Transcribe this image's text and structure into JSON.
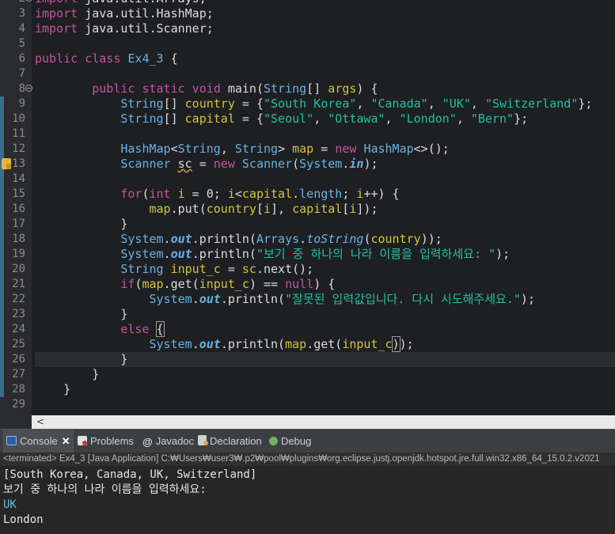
{
  "editor": {
    "lines": [
      {
        "n": "2",
        "fold": true,
        "tokens": [
          [
            "kw",
            "import"
          ],
          [
            "pu",
            " java.util.Arrays;"
          ]
        ]
      },
      {
        "n": "3",
        "tokens": [
          [
            "kw",
            "import"
          ],
          [
            "pu",
            " java.util.HashMap;"
          ]
        ]
      },
      {
        "n": "4",
        "tokens": [
          [
            "kw",
            "import"
          ],
          [
            "pu",
            " java.util.Scanner;"
          ]
        ]
      },
      {
        "n": "5",
        "tokens": []
      },
      {
        "n": "6",
        "tokens": [
          [
            "kw",
            "public class "
          ],
          [
            "ty",
            "Ex4_3"
          ],
          [
            "pu",
            " {"
          ]
        ]
      },
      {
        "n": "7",
        "tokens": []
      },
      {
        "n": "8",
        "fold": true,
        "tokens": [
          [
            "pu",
            "        "
          ],
          [
            "kw",
            "public static void "
          ],
          [
            "mth",
            "main"
          ],
          [
            "pu",
            "("
          ],
          [
            "ty",
            "String"
          ],
          [
            "pu",
            "[] "
          ],
          [
            "fld",
            "args"
          ],
          [
            "pu",
            ") {"
          ]
        ]
      },
      {
        "n": "9",
        "tokens": [
          [
            "pu",
            "            "
          ],
          [
            "ty",
            "String"
          ],
          [
            "pu",
            "[] "
          ],
          [
            "fld",
            "country"
          ],
          [
            "pu",
            " = {"
          ],
          [
            "str",
            "\"South Korea\""
          ],
          [
            "pu",
            ", "
          ],
          [
            "str",
            "\"Canada\""
          ],
          [
            "pu",
            ", "
          ],
          [
            "str",
            "\"UK\""
          ],
          [
            "pu",
            ", "
          ],
          [
            "str",
            "\"Switzerland\""
          ],
          [
            "pu",
            "};"
          ]
        ]
      },
      {
        "n": "10",
        "tokens": [
          [
            "pu",
            "            "
          ],
          [
            "ty",
            "String"
          ],
          [
            "pu",
            "[] "
          ],
          [
            "fld",
            "capital"
          ],
          [
            "pu",
            " = {"
          ],
          [
            "str",
            "\"Seoul\""
          ],
          [
            "pu",
            ", "
          ],
          [
            "str",
            "\"Ottawa\""
          ],
          [
            "pu",
            ", "
          ],
          [
            "str",
            "\"London\""
          ],
          [
            "pu",
            ", "
          ],
          [
            "str",
            "\"Bern\""
          ],
          [
            "pu",
            "};"
          ]
        ]
      },
      {
        "n": "11",
        "tokens": []
      },
      {
        "n": "12",
        "tokens": [
          [
            "pu",
            "            "
          ],
          [
            "ty",
            "HashMap"
          ],
          [
            "pu",
            "<"
          ],
          [
            "ty",
            "String"
          ],
          [
            "pu",
            ", "
          ],
          [
            "ty",
            "String"
          ],
          [
            "pu",
            "> "
          ],
          [
            "fld",
            "map"
          ],
          [
            "pu",
            " = "
          ],
          [
            "kw",
            "new "
          ],
          [
            "ty",
            "HashMap"
          ],
          [
            "pu",
            "<>();"
          ]
        ]
      },
      {
        "n": "13",
        "warn": true,
        "tokens": [
          [
            "pu",
            "            "
          ],
          [
            "ty",
            "Scanner "
          ],
          [
            "squig",
            "sc"
          ],
          [
            "pu",
            " = "
          ],
          [
            "kw",
            "new "
          ],
          [
            "ty",
            "Scanner"
          ],
          [
            "pu",
            "("
          ],
          [
            "ty",
            "System"
          ],
          [
            "pu",
            "."
          ],
          [
            "sfld",
            "in"
          ],
          [
            "pu",
            ");"
          ]
        ]
      },
      {
        "n": "14",
        "tokens": []
      },
      {
        "n": "15",
        "tokens": [
          [
            "pu",
            "            "
          ],
          [
            "kw",
            "for"
          ],
          [
            "pu",
            "("
          ],
          [
            "kw",
            "int "
          ],
          [
            "fld",
            "i"
          ],
          [
            "pu",
            " = 0; "
          ],
          [
            "fld",
            "i"
          ],
          [
            "pu",
            "<"
          ],
          [
            "fld",
            "capital"
          ],
          [
            "pu",
            "."
          ],
          [
            "ty",
            "length"
          ],
          [
            "pu",
            "; "
          ],
          [
            "fld",
            "i"
          ],
          [
            "pu",
            "++) {"
          ]
        ]
      },
      {
        "n": "16",
        "tokens": [
          [
            "pu",
            "                "
          ],
          [
            "fld",
            "map"
          ],
          [
            "pu",
            ".put("
          ],
          [
            "fld",
            "country"
          ],
          [
            "pu",
            "["
          ],
          [
            "fld",
            "i"
          ],
          [
            "pu",
            "], "
          ],
          [
            "fld",
            "capital"
          ],
          [
            "pu",
            "["
          ],
          [
            "fld",
            "i"
          ],
          [
            "pu",
            "]);"
          ]
        ]
      },
      {
        "n": "17",
        "tokens": [
          [
            "pu",
            "            }"
          ]
        ]
      },
      {
        "n": "18",
        "tokens": [
          [
            "pu",
            "            "
          ],
          [
            "ty",
            "System"
          ],
          [
            "pu",
            "."
          ],
          [
            "sfld",
            "out"
          ],
          [
            "pu",
            ".println("
          ],
          [
            "ty",
            "Arrays"
          ],
          [
            "pu",
            "."
          ],
          [
            "smt",
            "toString"
          ],
          [
            "pu",
            "("
          ],
          [
            "fld",
            "country"
          ],
          [
            "pu",
            "));"
          ]
        ]
      },
      {
        "n": "19",
        "tokens": [
          [
            "pu",
            "            "
          ],
          [
            "ty",
            "System"
          ],
          [
            "pu",
            "."
          ],
          [
            "sfld",
            "out"
          ],
          [
            "pu",
            ".println("
          ],
          [
            "str",
            "\"보기 중 하나의 나라 이름을 입력하세요: \""
          ],
          [
            "pu",
            ");"
          ]
        ]
      },
      {
        "n": "20",
        "tokens": [
          [
            "pu",
            "            "
          ],
          [
            "ty",
            "String "
          ],
          [
            "fld",
            "input_c"
          ],
          [
            "pu",
            " = "
          ],
          [
            "fld",
            "sc"
          ],
          [
            "pu",
            ".next();"
          ]
        ]
      },
      {
        "n": "21",
        "tokens": [
          [
            "pu",
            "            "
          ],
          [
            "kw",
            "if"
          ],
          [
            "pu",
            "("
          ],
          [
            "fld",
            "map"
          ],
          [
            "pu",
            ".get("
          ],
          [
            "fld",
            "input_c"
          ],
          [
            "pu",
            ") == "
          ],
          [
            "kw",
            "null"
          ],
          [
            "pu",
            ") {"
          ]
        ]
      },
      {
        "n": "22",
        "tokens": [
          [
            "pu",
            "                "
          ],
          [
            "ty",
            "System"
          ],
          [
            "pu",
            "."
          ],
          [
            "sfld",
            "out"
          ],
          [
            "pu",
            ".println("
          ],
          [
            "str",
            "\"잘못된 입력값입니다. 다시 시도해주세요.\""
          ],
          [
            "pu",
            ");"
          ]
        ]
      },
      {
        "n": "23",
        "tokens": [
          [
            "pu",
            "            }"
          ]
        ]
      },
      {
        "n": "24",
        "tokens": [
          [
            "pu",
            "            "
          ],
          [
            "kw",
            "else "
          ],
          [
            "caret",
            "{"
          ]
        ]
      },
      {
        "n": "25",
        "tokens": [
          [
            "pu",
            "                "
          ],
          [
            "ty",
            "System"
          ],
          [
            "pu",
            "."
          ],
          [
            "sfld",
            "out"
          ],
          [
            "pu",
            ".println("
          ],
          [
            "fld",
            "map"
          ],
          [
            "pu",
            ".get("
          ],
          [
            "fld",
            "input_c"
          ],
          [
            "caret",
            ")"
          ],
          [
            "pu",
            ");"
          ]
        ]
      },
      {
        "n": "26",
        "current": true,
        "tokens": [
          [
            "pu",
            "            }"
          ]
        ]
      },
      {
        "n": "27",
        "tokens": [
          [
            "pu",
            "        }"
          ]
        ]
      },
      {
        "n": "28",
        "tokens": [
          [
            "pu",
            "    }"
          ]
        ]
      },
      {
        "n": "29",
        "tokens": []
      }
    ],
    "hscroll_arrow": "<"
  },
  "tabs": [
    {
      "label": "Console",
      "icon": "console-icon",
      "active": true,
      "close": "✕"
    },
    {
      "label": "Problems",
      "icon": "problems-icon"
    },
    {
      "label": "Javadoc",
      "icon": "javadoc-icon",
      "glyph": "@"
    },
    {
      "label": "Declaration",
      "icon": "declaration-icon"
    },
    {
      "label": "Debug",
      "icon": "debug-icon"
    }
  ],
  "console": {
    "status": "<terminated> Ex4_3 [Java Application] C:₩Users₩user3₩.p2₩pool₩plugins₩org.eclipse.justj.openjdk.hotspot.jre.full.win32.x86_64_15.0.2.v2021",
    "output": [
      {
        "text": "[South Korea, Canada, UK, Switzerland]",
        "kind": "std"
      },
      {
        "text": "보기 중 하나의 나라 이름을 입력하세요:",
        "kind": "std"
      },
      {
        "text": "UK",
        "kind": "in"
      },
      {
        "text": "London",
        "kind": "std"
      }
    ]
  },
  "colors": {
    "keyword": "#c2559e",
    "type": "#66b3e6",
    "field": "#d4c43c",
    "string": "#21c1a3",
    "console_input": "#59c4cf"
  }
}
